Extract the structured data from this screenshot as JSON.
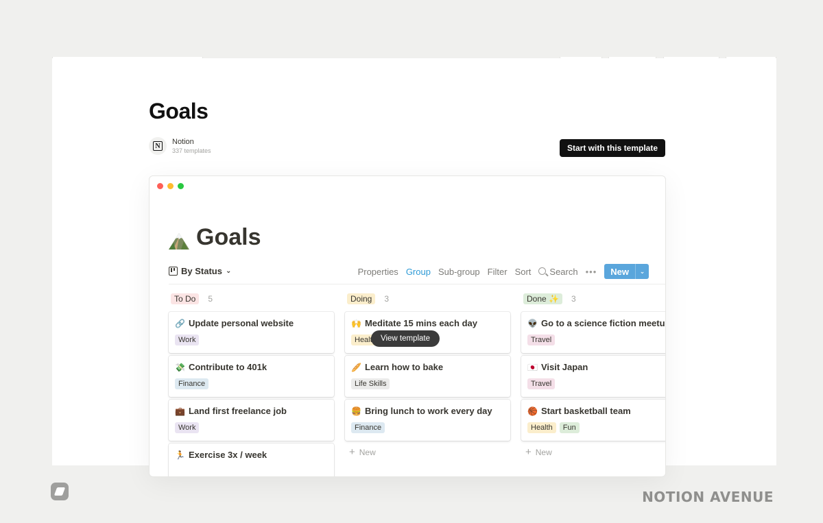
{
  "page": {
    "title": "Goals",
    "author": {
      "name": "Notion",
      "count": "337 templates",
      "logo": "N"
    },
    "start_button": "Start with this template"
  },
  "preview": {
    "title": "Goals",
    "title_icon": "mountain-icon",
    "view": {
      "label": "By Status",
      "icon": "board-icon"
    },
    "toolbar": {
      "properties": "Properties",
      "group": "Group",
      "subgroup": "Sub-group",
      "filter": "Filter",
      "sort": "Sort",
      "search": "Search",
      "more": "•••",
      "new": "New",
      "active_item": "Group"
    },
    "columns": [
      {
        "status": "To Do",
        "count": "5",
        "color": "#fbe4e4",
        "cards": [
          {
            "emoji": "🔗",
            "title": "Update personal website",
            "tags": [
              {
                "label": "Work",
                "color": "#eae4f2"
              }
            ]
          },
          {
            "emoji": "💸",
            "title": "Contribute to 401k",
            "tags": [
              {
                "label": "Finance",
                "color": "#dde9f1"
              }
            ]
          },
          {
            "emoji": "💼",
            "title": "Land first freelance job",
            "tags": [
              {
                "label": "Work",
                "color": "#eae4f2"
              }
            ]
          },
          {
            "emoji": "🏃",
            "title": "Exercise 3x / week",
            "tags": []
          }
        ]
      },
      {
        "status": "Doing",
        "count": "3",
        "color": "#fbeecc",
        "cards": [
          {
            "emoji": "🙌",
            "title": "Meditate 15 mins each day",
            "tags": [
              {
                "label": "Health",
                "color": "#fbeecc"
              }
            ]
          },
          {
            "emoji": "🥖",
            "title": "Learn how to bake",
            "tags": [
              {
                "label": "Life Skills",
                "color": "#ebebea"
              }
            ]
          },
          {
            "emoji": "🍔",
            "title": "Bring lunch to work every day",
            "tags": [
              {
                "label": "Finance",
                "color": "#dde9f1"
              }
            ]
          }
        ],
        "new_label": "New"
      },
      {
        "status": "Done ✨",
        "count": "3",
        "color": "#ddedda",
        "cards": [
          {
            "emoji": "👽",
            "title": "Go to a science fiction meetup",
            "tags": [
              {
                "label": "Travel",
                "color": "#f4dfe8"
              }
            ]
          },
          {
            "emoji": "🇯🇵",
            "title": "Visit Japan",
            "tags": [
              {
                "label": "Travel",
                "color": "#f4dfe8"
              }
            ]
          },
          {
            "emoji": "🏀",
            "title": "Start basketball team",
            "tags": [
              {
                "label": "Health",
                "color": "#fbeecc"
              },
              {
                "label": "Fun",
                "color": "#ddedda"
              }
            ]
          }
        ],
        "new_label": "New"
      }
    ],
    "tooltip": "View template"
  },
  "footer": {
    "brand": "NOTION AVENUE"
  }
}
